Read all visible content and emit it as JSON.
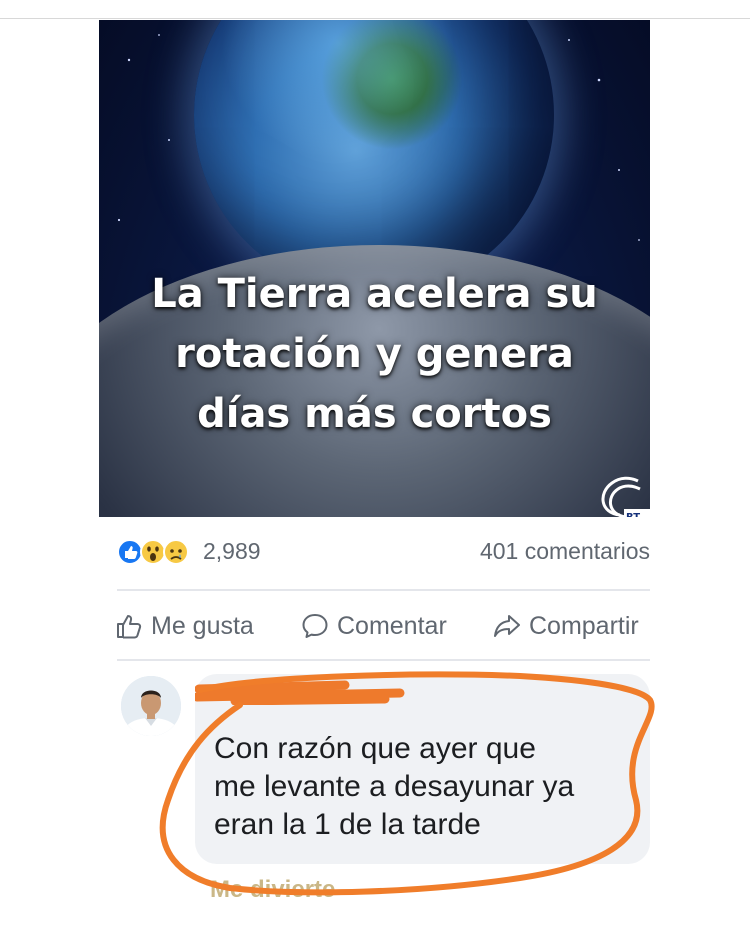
{
  "post": {
    "headline_lines": [
      "La Tierra acelera su",
      "rotación y genera",
      "días más cortos"
    ],
    "reactions": {
      "icons": [
        "like-reaction-icon",
        "wow-reaction-icon",
        "sad-reaction-icon"
      ],
      "count": "2,989"
    },
    "comments_count": "401 comentarios",
    "actions": {
      "like_label": "Me gusta",
      "comment_label": "Comentar",
      "share_label": "Compartir"
    }
  },
  "comment": {
    "text_lines": [
      "Con razón que ayer que",
      "me levante a desayunar ya",
      "eran la 1 de la tarde"
    ],
    "reaction_label": "Me divierte",
    "highlight_color": "#f07d2a"
  },
  "colors": {
    "meta_text": "#606770",
    "like_blue": "#1877f2",
    "bubble_bg": "#f0f2f5"
  }
}
